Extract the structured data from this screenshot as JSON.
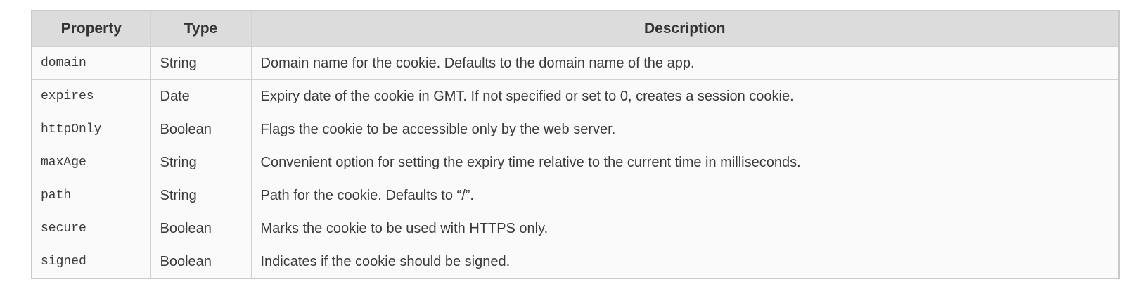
{
  "table": {
    "headers": {
      "property": "Property",
      "type": "Type",
      "description": "Description"
    },
    "rows": [
      {
        "property": "domain",
        "type": "String",
        "description": "Domain name for the cookie. Defaults to the domain name of the app."
      },
      {
        "property": "expires",
        "type": "Date",
        "description": "Expiry date of the cookie in GMT. If not specified or set to 0, creates a session cookie."
      },
      {
        "property": "httpOnly",
        "type": "Boolean",
        "description": "Flags the cookie to be accessible only by the web server."
      },
      {
        "property": "maxAge",
        "type": "String",
        "description": "Convenient option for setting the expiry time relative to the current time in milliseconds."
      },
      {
        "property": "path",
        "type": "String",
        "description": "Path for the cookie. Defaults to “/”."
      },
      {
        "property": "secure",
        "type": "Boolean",
        "description": "Marks the cookie to be used with HTTPS only."
      },
      {
        "property": "signed",
        "type": "Boolean",
        "description": "Indicates if the cookie should be signed."
      }
    ]
  }
}
